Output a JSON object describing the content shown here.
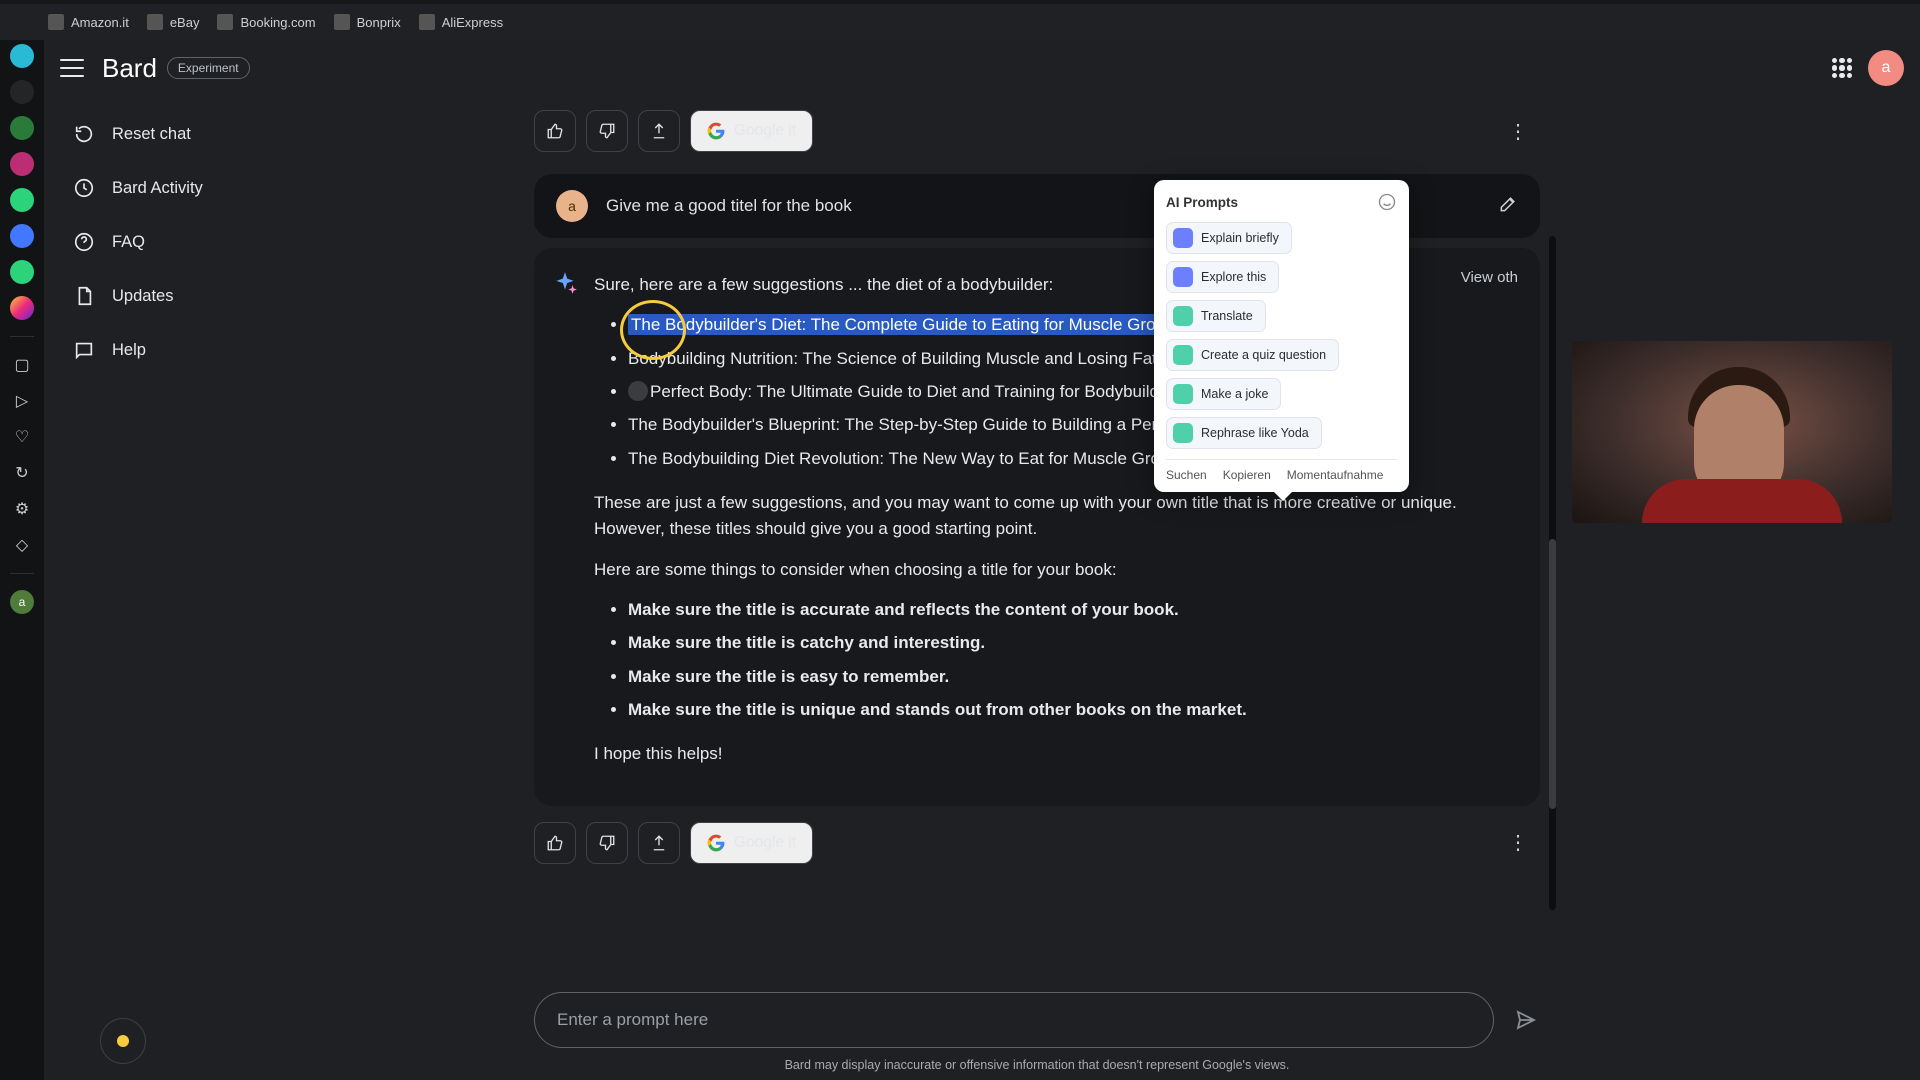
{
  "bookmarks": [
    {
      "label": "Amazon.it"
    },
    {
      "label": "eBay"
    },
    {
      "label": "Booking.com"
    },
    {
      "label": "Bonprix"
    },
    {
      "label": "AliExpress"
    }
  ],
  "header": {
    "brand": "Bard",
    "badge": "Experiment",
    "avatar_initial": "a"
  },
  "sidebar": {
    "items": [
      {
        "label": "Reset chat"
      },
      {
        "label": "Bard Activity"
      },
      {
        "label": "FAQ"
      },
      {
        "label": "Updates"
      },
      {
        "label": "Help"
      }
    ]
  },
  "chat": {
    "google_it": "Google it",
    "user_initial": "a",
    "user_message": "Give me a good titel for the book",
    "view_other": "View oth",
    "intro": "Sure, here are a few suggestions ... the diet of a bodybuilder:",
    "titles": [
      "The Bodybuilder's Diet: The Complete Guide to Eating for Muscle Growth and Fat Loss",
      "Bodybuilding Nutrition: The Science of Building Muscle and Losing Fat",
      "Perfect Body: The Ultimate Guide to Diet and Training for Bodybuilding",
      "The Bodybuilder's Blueprint: The Step-by-Step Guide to Building a Perfect Physique",
      "The Bodybuilding Diet Revolution: The New Way to Eat for Muscle Growth and Fat Loss"
    ],
    "para_after": "These are just a few suggestions, and you may want to come up with your own title that is more creative or unique. However, these titles should give you a good starting point.",
    "consider": "Here are some things to consider when choosing a title for your book:",
    "tips": [
      "Make sure the title is accurate and reflects the content of your book.",
      "Make sure the title is catchy and interesting.",
      "Make sure the title is easy to remember.",
      "Make sure the title is unique and stands out from other books on the market."
    ],
    "closing": "I hope this helps!",
    "prompt_placeholder": "Enter a prompt here",
    "disclaimer": "Bard may display inaccurate or offensive information that doesn't represent Google's views."
  },
  "popover": {
    "title": "AI Prompts",
    "chips": [
      {
        "variant": "blue",
        "label": "Explain briefly"
      },
      {
        "variant": "blue",
        "label": "Explore this"
      },
      {
        "variant": "teal",
        "label": "Translate"
      },
      {
        "variant": "teal",
        "label": "Create a quiz question"
      },
      {
        "variant": "teal",
        "label": "Make a joke"
      },
      {
        "variant": "teal",
        "label": "Rephrase like Yoda"
      }
    ],
    "footer": [
      "Suchen",
      "Kopieren",
      "Momentaufnahme"
    ]
  }
}
